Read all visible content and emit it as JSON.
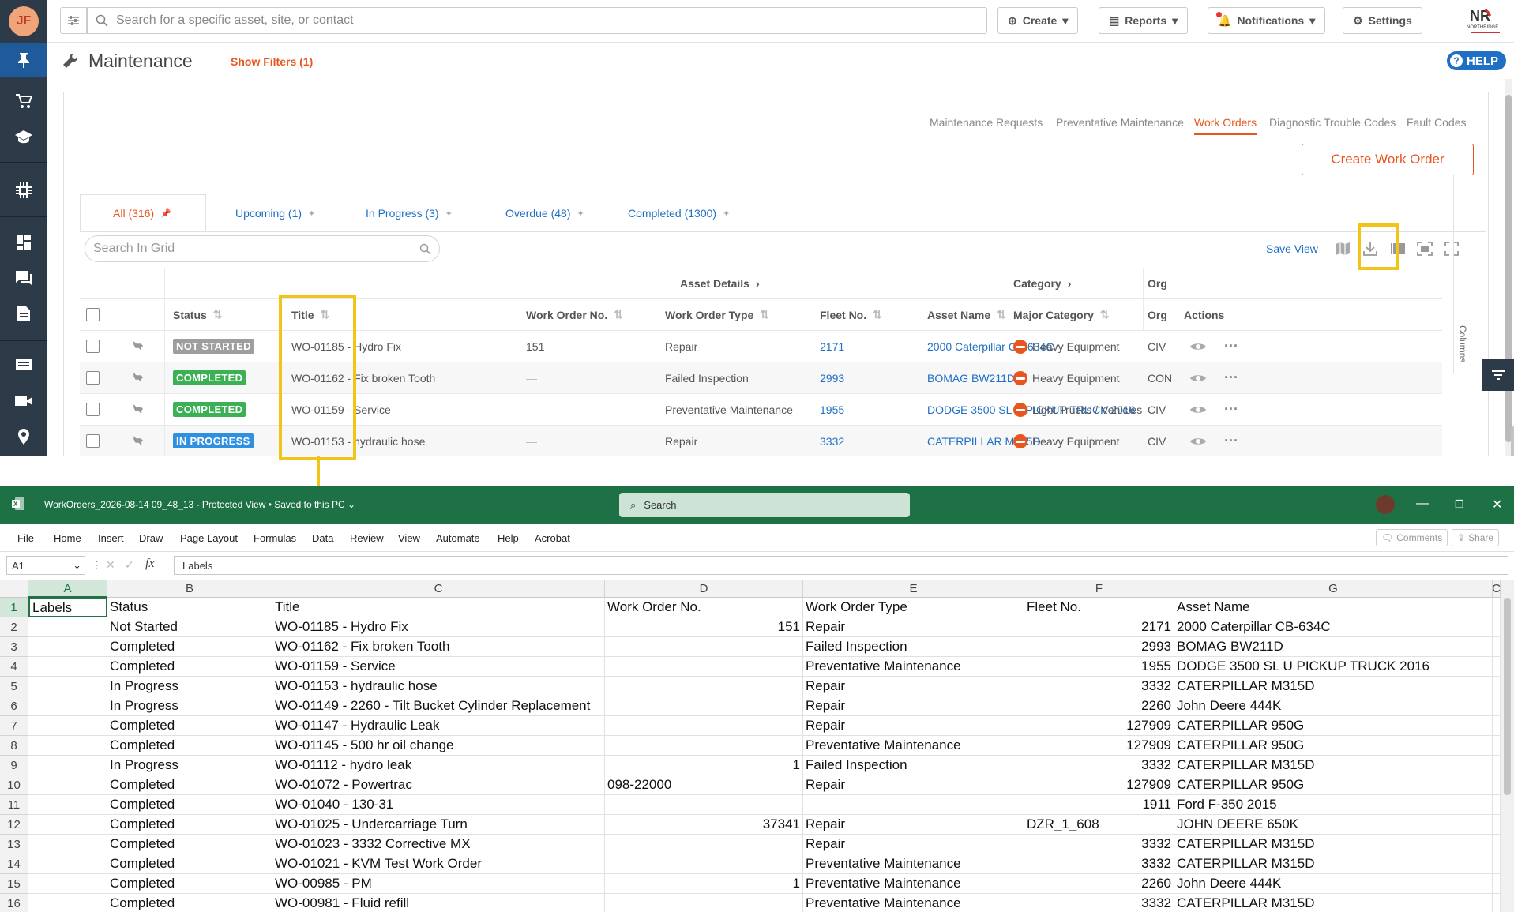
{
  "app": {
    "user_initials": "JF",
    "search_placeholder": "Search for a specific asset, site, or contact",
    "top_buttons": {
      "create": "Create",
      "reports": "Reports",
      "notifications": "Notifications",
      "settings": "Settings"
    },
    "logo_text": "NORTHRIDGE",
    "page_title": "Maintenance",
    "show_filters": "Show Filters (1)",
    "help": "HELP",
    "subnav": [
      "Maintenance Requests",
      "Preventative Maintenance",
      "Work Orders",
      "Diagnostic Trouble Codes",
      "Fault Codes"
    ],
    "subnav_active": "Work Orders",
    "create_work_order": "Create Work Order",
    "tabs": [
      "All (316)",
      "Upcoming (1)",
      "In Progress (3)",
      "Overdue (48)",
      "Completed (1300)"
    ],
    "grid_search_placeholder": "Search In Grid",
    "save_view": "Save View",
    "group_headers": {
      "asset_details": "Asset Details",
      "category": "Category",
      "org": "Org"
    },
    "columns": {
      "status": "Status",
      "title": "Title",
      "work_order_no": "Work Order No.",
      "work_order_type": "Work Order Type",
      "fleet_no": "Fleet No.",
      "asset_name": "Asset Name",
      "major_category": "Major Category",
      "org": "Org",
      "actions": "Actions"
    },
    "columns_toggle": "Columns",
    "rows": [
      {
        "status": "NOT STARTED",
        "status_color": "#9e9e9e",
        "title": "WO-01185 - Hydro Fix",
        "wo_no": "151",
        "type": "Repair",
        "fleet": "2171",
        "asset": "2000 Caterpillar CB-634C",
        "category": "Heavy Equipment",
        "org": "CIV"
      },
      {
        "status": "COMPLETED",
        "status_color": "#3cb054",
        "title": "WO-01162 - Fix broken Tooth",
        "wo_no": "—",
        "type": "Failed Inspection",
        "fleet": "2993",
        "asset": "BOMAG BW211D",
        "category": "Heavy Equipment",
        "org": "CON"
      },
      {
        "status": "COMPLETED",
        "status_color": "#3cb054",
        "title": "WO-01159 - Service",
        "wo_no": "—",
        "type": "Preventative Maintenance",
        "fleet": "1955",
        "asset": "DODGE 3500 SL U PICKUP TRUCK 2016",
        "category": "Light Trucks / Vehicles",
        "org": "CIV"
      },
      {
        "status": "IN PROGRESS",
        "status_color": "#2f8fe0",
        "title": "WO-01153 - hydraulic hose",
        "wo_no": "—",
        "type": "Repair",
        "fleet": "3332",
        "asset": "CATERPILLAR M315D",
        "category": "Heavy Equipment",
        "org": "CIV"
      }
    ],
    "colors": {
      "accent": "#e8561e",
      "link": "#1f6fc4",
      "highlight": "#f2c318"
    }
  },
  "excel": {
    "file_title": "WorkOrders_2026-08-14 09_48_13  -  Protected View  •  Saved to this PC",
    "search": "Search",
    "menu": [
      "File",
      "Home",
      "Insert",
      "Draw",
      "Page Layout",
      "Formulas",
      "Data",
      "Review",
      "View",
      "Automate",
      "Help",
      "Acrobat"
    ],
    "comments": "Comments",
    "share": "Share",
    "name_box": "A1",
    "fx": "fx",
    "formula_value": "Labels",
    "col_letters": [
      "A",
      "B",
      "C",
      "D",
      "E",
      "F",
      "G"
    ],
    "extra_col_letter": "C",
    "rows": [
      [
        "Labels",
        "Status",
        "Title",
        "Work Order No.",
        "Work Order Type",
        "Fleet No.",
        "Asset Name"
      ],
      [
        "",
        "Not Started",
        "WO-01185 - Hydro Fix",
        "151",
        "Repair",
        "2171",
        "2000 Caterpillar CB-634C"
      ],
      [
        "",
        "Completed",
        "WO-01162 - Fix broken Tooth",
        "",
        "Failed Inspection",
        "2993",
        "BOMAG BW211D"
      ],
      [
        "",
        "Completed",
        "WO-01159 - Service",
        "",
        "Preventative Maintenance",
        "1955",
        "DODGE 3500 SL U PICKUP TRUCK 2016"
      ],
      [
        "",
        "In Progress",
        "WO-01153 - hydraulic hose",
        "",
        "Repair",
        "3332",
        "CATERPILLAR M315D"
      ],
      [
        "",
        "In Progress",
        "WO-01149 - 2260 - Tilt Bucket Cylinder Replacement",
        "",
        "Repair",
        "2260",
        "John Deere 444K"
      ],
      [
        "",
        "Completed",
        "WO-01147 - Hydraulic Leak",
        "",
        "Repair",
        "127909",
        "CATERPILLAR 950G"
      ],
      [
        "",
        "Completed",
        "WO-01145 - 500 hr oil change",
        "",
        "Preventative Maintenance",
        "127909",
        "CATERPILLAR 950G"
      ],
      [
        "",
        "In Progress",
        "WO-01112 - hydro leak",
        "1",
        "Failed Inspection",
        "3332",
        "CATERPILLAR M315D"
      ],
      [
        "",
        "Completed",
        "WO-01072 - Powertrac",
        "098-22000",
        "Repair",
        "127909",
        "CATERPILLAR 950G"
      ],
      [
        "",
        "Completed",
        "WO-01040 - 130-31",
        "",
        "",
        "1911",
        "Ford F-350 2015"
      ],
      [
        "",
        "Completed",
        "WO-01025 - Undercarriage Turn",
        "37341",
        "Repair",
        "DZR_1_608",
        "JOHN DEERE 650K"
      ],
      [
        "",
        "Completed",
        "WO-01023 - 3332 Corrective MX",
        "",
        "Repair",
        "3332",
        "CATERPILLAR M315D"
      ],
      [
        "",
        "Completed",
        "WO-01021 - KVM Test Work Order",
        "",
        "Preventative Maintenance",
        "3332",
        "CATERPILLAR M315D"
      ],
      [
        "",
        "Completed",
        "WO-00985 - PM",
        "1",
        "Preventative Maintenance",
        "2260",
        "John Deere 444K"
      ],
      [
        "",
        "Completed",
        "WO-00981 - Fluid refill",
        "",
        "Preventative Maintenance",
        "3332",
        "CATERPILLAR M315D"
      ]
    ]
  }
}
